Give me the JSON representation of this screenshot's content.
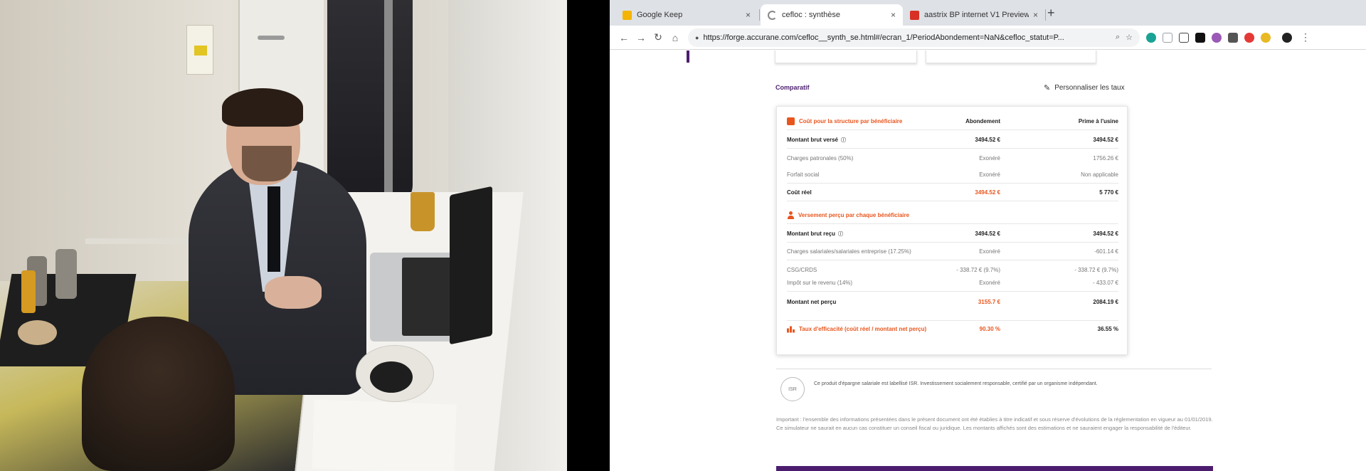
{
  "browser": {
    "tabs": [
      {
        "title": "Google Keep",
        "favicon_color": "#f4b400",
        "active": false
      },
      {
        "title": "cefloc : synthèse",
        "favicon_color": "#888888",
        "active": true
      },
      {
        "title": "aastrix BP internet V1 Preview",
        "favicon_color": "#d93025",
        "active": false
      }
    ],
    "new_tab": "+",
    "close_glyph": "×",
    "url": "https://forge.accurane.com/cefloc__synth_se.html#/ecran_1/PeriodAbondement=NaN&cefloc_statut=P...",
    "nav": {
      "back": "←",
      "forward": "→",
      "reload": "↻",
      "home": "⌂"
    },
    "omnibox_icons": {
      "lock": "●",
      "zoom": "⌕",
      "star": "☆"
    },
    "extension_colors": [
      "#1aa394",
      "#9aa0a6",
      "#444444",
      "#111111",
      "#9b59b6",
      "#555555",
      "#e53935",
      "#e8b923",
      "#222222"
    ],
    "menu": "⋮"
  },
  "page": {
    "section_title": "Comparatif",
    "personalize_label": "Personnaliser les taux",
    "table": {
      "header": {
        "label": "Coût pour la structure par bénéficiaire",
        "col2": "Abondement",
        "col3": "Prime à l'usine"
      },
      "rows": [
        {
          "label": "Montant brut versé",
          "info": "ⓘ",
          "col2": "3494.52 €",
          "col3": "3494.52 €",
          "style": "bold line"
        },
        {
          "label": "Charges patronales (50%)",
          "info": "",
          "col2": "Exonéré",
          "col3": "1756.26 €",
          "style": "muted"
        },
        {
          "label": "Forfait social",
          "info": "",
          "col2": "Exonéré",
          "col3": "Non applicable",
          "style": "muted line"
        },
        {
          "label": "Coût réel",
          "info": "",
          "col2": "3494.52 €",
          "col3": "5 770 €",
          "style": "bold line",
          "col2_orange": true
        }
      ],
      "header2": {
        "label": "Versement perçu par chaque bénéficiaire"
      },
      "rows2": [
        {
          "label": "Montant brut reçu",
          "info": "ⓘ",
          "col2": "3494.52 €",
          "col3": "3494.52 €",
          "style": "bold line"
        },
        {
          "label": "Charges salariales/salariales entreprise (17.25%)",
          "info": "",
          "col2": "Exonéré",
          "col3": "-601.14 €",
          "style": "muted line"
        },
        {
          "label": "CSG/CRDS",
          "info": "",
          "col2": "- 338.72 € (9.7%)",
          "col3": "- 338.72 € (9.7%)",
          "style": "muted"
        },
        {
          "label": "Impôt sur le revenu (14%)",
          "info": "",
          "col2": "Exonéré",
          "col3": "- 433.07 €",
          "style": "muted line"
        },
        {
          "label": "Montant net perçu",
          "info": "",
          "col2": "3155.7 €",
          "col3": "2084.19 €",
          "style": "bold",
          "col2_orange": true
        }
      ],
      "footer": {
        "label": "Taux d'efficacité (coût réel / montant net perçu)",
        "col2": "90.30 %",
        "col3": "36.55 %"
      }
    },
    "mark_label": "ISR",
    "mark_text": "Ce produit d'épargne salariale est labellisé ISR. Investissement socialement responsable, certifié par un organisme indépendant.",
    "disclaimer": "Important : l'ensemble des informations présentées dans le présent document ont été établies à titre indicatif et sous réserve d'évolutions de la réglementation en vigueur au 01/01/2019. Ce simulateur ne saurait en aucun cas constituer un conseil fiscal ou juridique. Les montants affichés sont des estimations et ne sauraient engager la responsabilité de l'éditeur."
  }
}
